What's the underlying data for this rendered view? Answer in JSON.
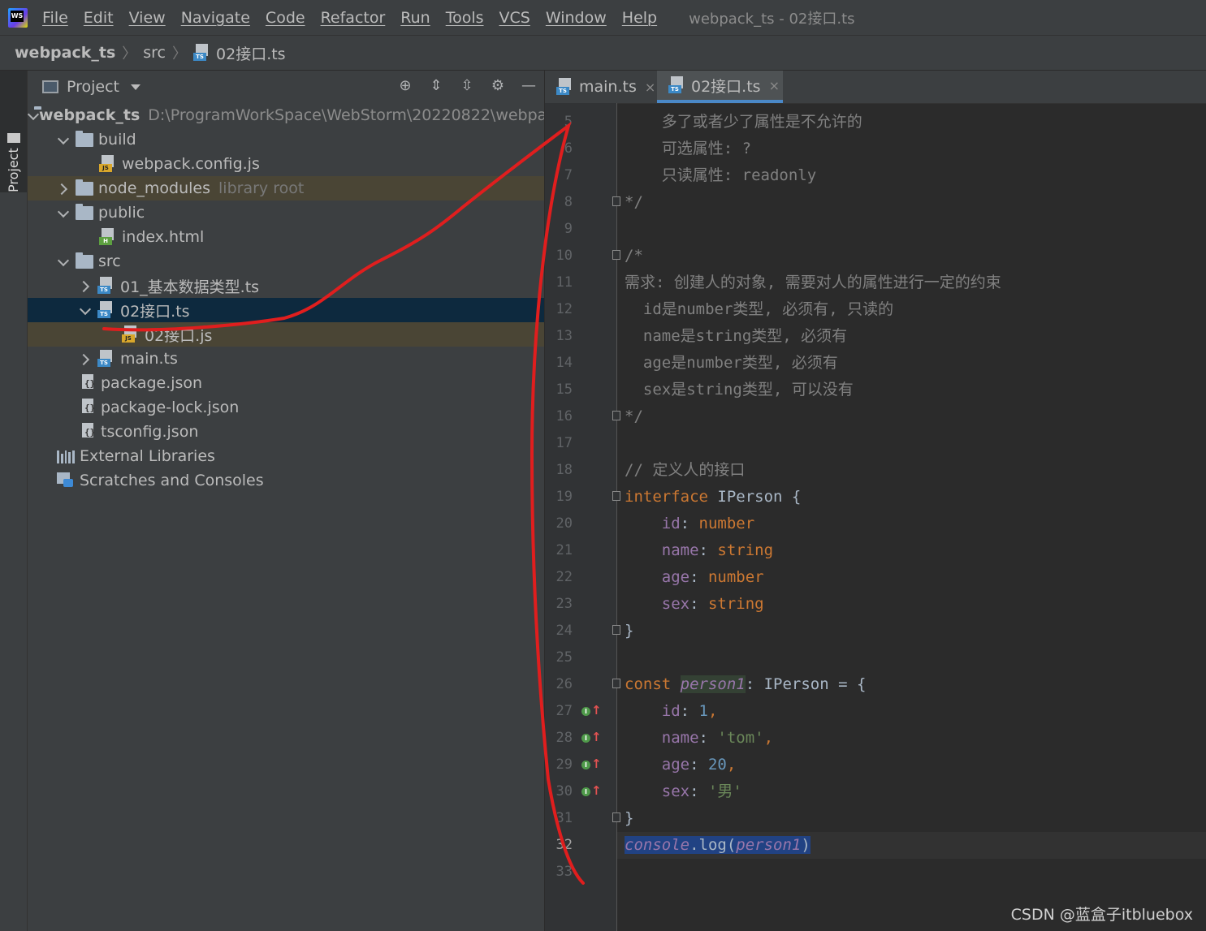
{
  "menubar": {
    "items": [
      "File",
      "Edit",
      "View",
      "Navigate",
      "Code",
      "Refactor",
      "Run",
      "Tools",
      "VCS",
      "Window",
      "Help"
    ],
    "window_title": "webpack_ts - 02接口.ts"
  },
  "breadcrumb": {
    "project": "webpack_ts",
    "folder": "src",
    "file": "02接口.ts"
  },
  "toolwindow": {
    "label": "Project"
  },
  "project_panel": {
    "title": "Project",
    "tree": {
      "root_name": "webpack_ts",
      "root_path": "D:\\ProgramWorkSpace\\WebStorm\\20220822\\webpac",
      "build": "build",
      "webpack_config": "webpack.config.js",
      "node_modules": "node_modules",
      "node_modules_hint": "library root",
      "public": "public",
      "index_html": "index.html",
      "src": "src",
      "file01": "01_基本数据类型.ts",
      "file02": "02接口.ts",
      "file02_js": "02接口.js",
      "main_ts": "main.ts",
      "package_json": "package.json",
      "package_lock": "package-lock.json",
      "tsconfig": "tsconfig.json",
      "external_libraries": "External Libraries",
      "scratches": "Scratches and Consoles"
    }
  },
  "editor": {
    "tabs": [
      {
        "label": "main.ts",
        "close": "×"
      },
      {
        "label": "02接口.ts",
        "close": "×"
      }
    ],
    "line_numbers": [
      "5",
      "6",
      "7",
      "8",
      "9",
      "10",
      "11",
      "12",
      "13",
      "14",
      "15",
      "16",
      "17",
      "18",
      "19",
      "20",
      "21",
      "22",
      "23",
      "24",
      "25",
      "26",
      "27",
      "28",
      "29",
      "30",
      "31",
      "32",
      "33"
    ],
    "code": {
      "l5": "多了或者少了属性是不允许的",
      "l6": "可选属性: ?",
      "l7": "只读属性: readonly",
      "l8": "*/",
      "l10": "/*",
      "l11": "需求: 创建人的对象, 需要对人的属性进行一定的约束",
      "l12": "  id是number类型, 必须有, 只读的",
      "l13": "  name是string类型, 必须有",
      "l14": "  age是number类型, 必须有",
      "l15": "  sex是string类型, 可以没有",
      "l16": "*/",
      "l18": "// 定义人的接口",
      "kw_interface": "interface",
      "iperson": " IPerson {",
      "p_id": "id",
      "t_number": "number",
      "p_name": "name",
      "t_string": "string",
      "p_age": "age",
      "p_sex": "sex",
      "close_brace": "}",
      "kw_const": "const",
      "v_person1": "person1",
      "decl_rest": ": IPerson = {",
      "v_id": "1",
      "v_name": "'tom'",
      "v_age": "20",
      "v_sex": "'男'",
      "console": "console",
      "log": ".log(",
      "arg": "person1",
      "close_paren": ")"
    }
  },
  "watermark": "CSDN @蓝盒子itbluebox",
  "colors": {
    "background": "#2b2b2b",
    "panel": "#3c3f41",
    "selection": "#0d293e",
    "keyword": "#cc7832",
    "property": "#9876aa",
    "string": "#6a8759",
    "number": "#6897bb",
    "annotation_stroke": "#e01e1e"
  }
}
